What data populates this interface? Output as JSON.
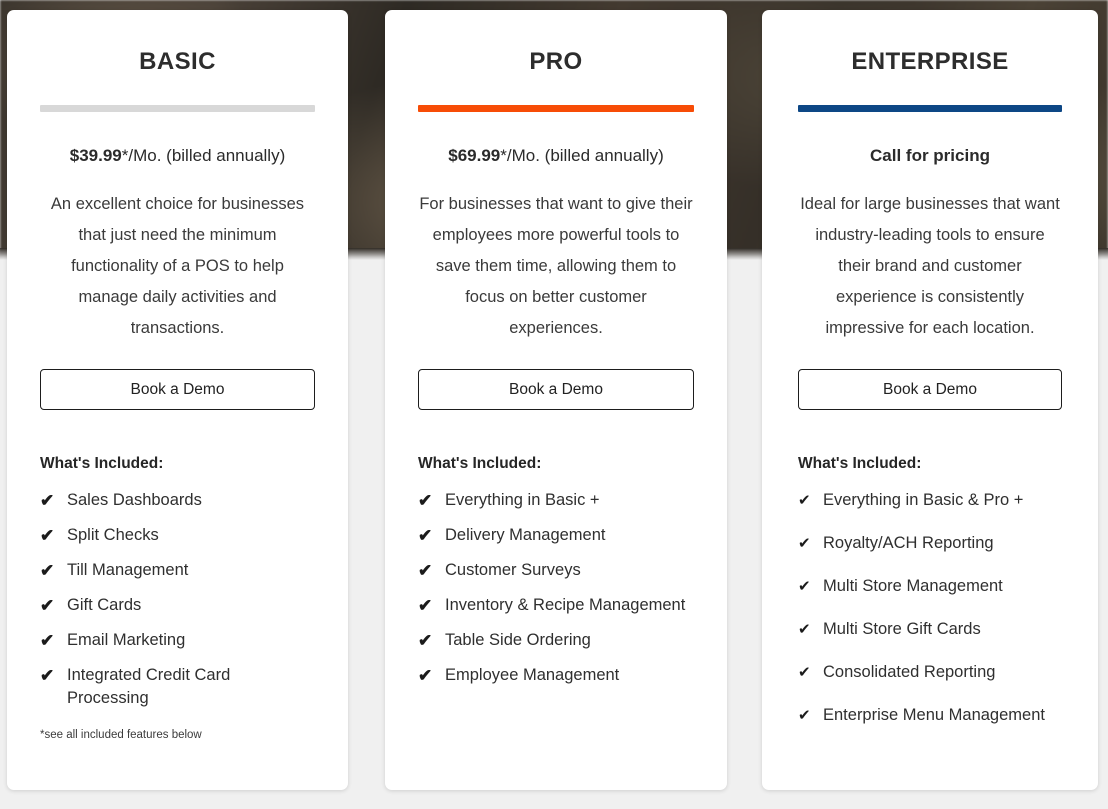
{
  "page": {
    "background_color": "#f0f0f0",
    "hero_band_color": "#3a332b"
  },
  "plans": [
    {
      "id": "basic",
      "title": "BASIC",
      "accent_color": "#d8d8d8",
      "price_amount": "$39.99",
      "price_suffix": "*/Mo. (billed annually)",
      "price_is_callout": false,
      "description": "An excellent choice for businesses that just need the minimum functionality of a POS to help manage daily activities and transactions.",
      "cta_label": "Book a Demo",
      "included_title": "What's Included:",
      "check_icon": "✔",
      "features": [
        "Sales Dashboards",
        "Split Checks",
        "Till Management",
        "Gift Cards",
        "Email Marketing",
        "Integrated Credit Card Processing"
      ],
      "footnote": "*see all included features below"
    },
    {
      "id": "pro",
      "title": "PRO",
      "accent_color": "#f74c06",
      "price_amount": "$69.99",
      "price_suffix": "*/Mo. (billed annually)",
      "price_is_callout": false,
      "description": "For businesses that want to give their employees more powerful tools to save them time, allowing them to focus on better customer experiences.",
      "cta_label": "Book a Demo",
      "included_title": "What's Included:",
      "check_icon": "✔",
      "features": [
        "Everything in Basic +",
        "Delivery Management",
        "Customer Surveys",
        "Inventory & Recipe Management",
        "Table Side Ordering",
        "Employee Management"
      ],
      "footnote": ""
    },
    {
      "id": "enterprise",
      "title": "ENTERPRISE",
      "accent_color": "#0d4785",
      "price_amount": "Call for pricing",
      "price_suffix": "",
      "price_is_callout": true,
      "description": "Ideal for large businesses that want industry-leading tools to ensure their brand and customer experience is consistently impressive for each location.",
      "cta_label": "Book a Demo",
      "included_title": "What's Included:",
      "check_icon": "✔",
      "features": [
        "Everything in Basic & Pro +",
        "Royalty/ACH Reporting",
        "Multi Store Management",
        "Multi Store Gift Cards",
        "Consolidated Reporting",
        "Enterprise Menu Management"
      ],
      "footnote": ""
    }
  ]
}
